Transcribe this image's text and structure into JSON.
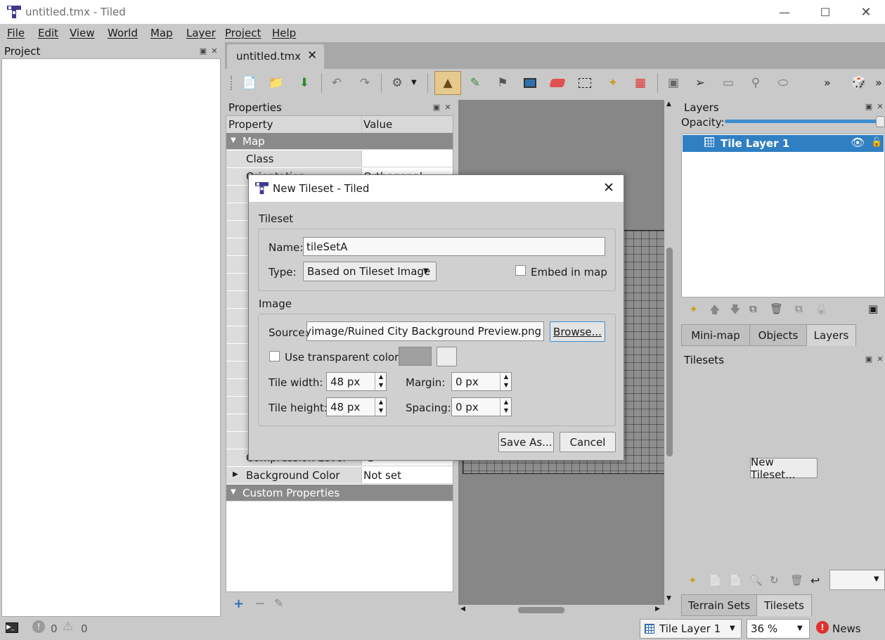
{
  "window": {
    "title": "untitled.tmx - Tiled"
  },
  "menu": [
    "File",
    "Edit",
    "View",
    "World",
    "Map",
    "Layer",
    "Project",
    "Help"
  ],
  "project_panel": {
    "title": "Project"
  },
  "document_tab": {
    "label": "untitled.tmx"
  },
  "properties": {
    "title": "Properties",
    "headers": {
      "property": "Property",
      "value": "Value"
    },
    "map_group": "Map",
    "class_row": {
      "key": "Class",
      "value": ""
    },
    "orientation_row": {
      "key": "Orientation",
      "value": "Orthogonal"
    },
    "compression_row": {
      "key": "Compression Level",
      "value": "-1"
    },
    "background_row": {
      "key": "Background Color",
      "value": "Not set"
    },
    "custom_group": "Custom Properties"
  },
  "layers_panel": {
    "title": "Layers",
    "opacity_label": "Opacity:",
    "opacity": 1.0,
    "layer_name": "Tile Layer 1",
    "tabs": [
      "Mini-map",
      "Objects",
      "Layers"
    ],
    "active_tab": "Layers"
  },
  "tilesets_panel": {
    "title": "Tilesets",
    "new_button": "New Tileset...",
    "tabs": [
      "Terrain Sets",
      "Tilesets"
    ],
    "active_tab": "Tilesets"
  },
  "status": {
    "errors": "0",
    "warnings": "0",
    "layer_combo": "Tile Layer 1",
    "zoom": "36 %",
    "news": "News"
  },
  "dialog": {
    "title": "New Tileset - Tiled",
    "tileset_group": "Tileset",
    "name_label": "Name:",
    "name_value": "tileSetA",
    "type_label": "Type:",
    "type_value": "Based on Tileset Image",
    "embed_label": "Embed in map",
    "embed_checked": false,
    "image_group": "Image",
    "source_label": "Source:",
    "source_value": "unityimage/Ruined City Background Preview.png",
    "browse_button": "Browse...",
    "transparent_label": "Use transparent color:",
    "transparent_checked": false,
    "tile_width_label": "Tile width:",
    "tile_width_value": "48 px",
    "tile_height_label": "Tile height:",
    "tile_height_value": "48 px",
    "margin_label": "Margin:",
    "margin_value": "0 px",
    "spacing_label": "Spacing:",
    "spacing_value": "0 px",
    "save_button": "Save As...",
    "cancel_button": "Cancel"
  },
  "colors": {
    "accent": "#3d8ecf",
    "selection": "#2f7fc2",
    "group_header": "#8a8a8a",
    "error": "#e0332f"
  }
}
